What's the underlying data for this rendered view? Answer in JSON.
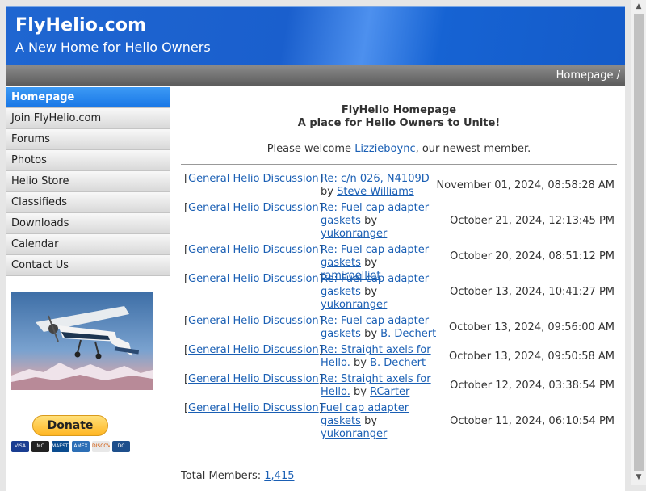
{
  "header": {
    "title": "FlyHelio.com",
    "tagline": "A New Home for Helio Owners"
  },
  "breadcrumb": "Homepage /",
  "nav": [
    "Homepage",
    "Join FlyHelio.com",
    "Forums",
    "Photos",
    "Helio Store",
    "Classifieds",
    "Downloads",
    "Calendar",
    "Contact Us"
  ],
  "donate": {
    "label": "Donate",
    "cards": [
      "VISA",
      "MC",
      "MAESTRO",
      "AMEX",
      "DISCOVER",
      "DC"
    ]
  },
  "main": {
    "title": "FlyHelio Homepage",
    "subtitle": "A place for Helio Owners to Unite!",
    "welcome_prefix": "Please welcome ",
    "welcome_user": "Lizzieboync",
    "welcome_suffix": ", our newest member.",
    "posts": [
      {
        "category": "General Helio Discussion",
        "topic": "Re: c/n 026, N4109D",
        "author": "Steve Williams",
        "date": "November 01, 2024, 08:58:28 AM"
      },
      {
        "category": "General Helio Discussion",
        "topic": "Re: Fuel cap adapter gaskets",
        "author": "yukonranger",
        "date": "October 21, 2024, 12:13:45 PM"
      },
      {
        "category": "General Helio Discussion",
        "topic": "Re: Fuel cap adapter gaskets",
        "author": "ramiroelliot",
        "date": "October 20, 2024, 08:51:12 PM"
      },
      {
        "category": "General Helio Discussion",
        "topic": "Re: Fuel cap adapter gaskets",
        "author": "yukonranger",
        "date": "October 13, 2024, 10:41:27 PM"
      },
      {
        "category": "General Helio Discussion",
        "topic": "Re: Fuel cap adapter gaskets",
        "author": "B. Dechert",
        "date": "October 13, 2024, 09:56:00 AM"
      },
      {
        "category": "General Helio Discussion",
        "topic": "Re: Straight axels for Hello.",
        "author": "B. Dechert",
        "date": "October 13, 2024, 09:50:58 AM"
      },
      {
        "category": "General Helio Discussion",
        "topic": "Re: Straight axels for Hello.",
        "author": "RCarter",
        "date": "October 12, 2024, 03:38:54 PM"
      },
      {
        "category": "General Helio Discussion",
        "topic": "Fuel cap adapter gaskets",
        "author": "yukonranger",
        "date": "October 11, 2024, 06:10:54 PM"
      }
    ],
    "total_label": "Total Members: ",
    "total_value": "1,415"
  }
}
